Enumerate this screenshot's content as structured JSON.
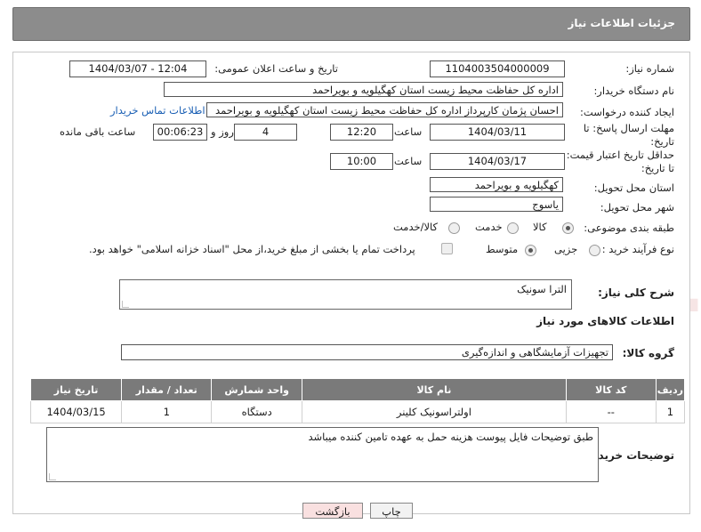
{
  "header": {
    "title": "جزئیات اطلاعات نیاز"
  },
  "watermark": {
    "text": "AriaTender.neT"
  },
  "fields": {
    "need_number_label": "شماره نیاز:",
    "need_number": "1104003504000009",
    "announce_label": "تاریخ و ساعت اعلان عمومی:",
    "announce_value": "1404/03/07 - 12:04",
    "buyer_org_label": "نام دستگاه خریدار:",
    "buyer_org": "اداره کل حفاظت محیط زیست استان کهگیلویه و بویراحمد",
    "creator_label": "ایجاد کننده درخواست:",
    "creator": "احسان پژمان کارپرداز اداره کل حفاظت محیط زیست استان کهگیلویه و بویراحمد",
    "buyer_contact_link": "اطلاعات تماس خریدار",
    "deadline_label": "مهلت ارسال پاسخ: تا تاریخ:",
    "deadline_date": "1404/03/11",
    "time_label": "ساعت",
    "deadline_time": "12:20",
    "days_value": "4",
    "days_label": "روز و",
    "remaining_time": "00:06:23",
    "remaining_label": "ساعت باقی مانده",
    "price_validity_label": "حداقل تاریخ اعتبار قیمت: تا تاریخ:",
    "price_validity_date": "1404/03/17",
    "price_validity_time": "10:00",
    "province_label": "استان محل تحویل:",
    "province": "کهگیلویه و بویراحمد",
    "city_label": "شهر محل تحویل:",
    "city": "یاسوج",
    "category_label": "طبقه بندی موضوعی:",
    "category_options": [
      "کالا",
      "خدمت",
      "کالا/خدمت"
    ],
    "process_label": "نوع فرآیند خرید :",
    "process_options": [
      "جزیی",
      "متوسط"
    ],
    "payment_note": "پرداخت تمام یا بخشی از مبلغ خرید،از محل \"اسناد خزانه اسلامی\" خواهد بود."
  },
  "description": {
    "label": "شرح کلی نیاز:",
    "value": "الترا سونیک"
  },
  "goods_section": {
    "title": "اطلاعات کالاهای مورد نیاز",
    "group_label": "گروه کالا:",
    "group_value": "تجهیزات آزمایشگاهی و اندازه‌گیری"
  },
  "table": {
    "headers": [
      "ردیف",
      "کد کالا",
      "نام کالا",
      "واحد شمارش",
      "تعداد / مقدار",
      "تاریخ نیاز"
    ],
    "rows": [
      [
        "1",
        "--",
        "اولتراسونیک کلینر",
        "دستگاه",
        "1",
        "1404/03/15"
      ]
    ]
  },
  "buyer_notes": {
    "label": "توضیحات خریدار:",
    "value": "طبق توضیحات فایل پیوست هزینه حمل  به عهده تامین کننده میباشد"
  },
  "buttons": {
    "print": "چاپ",
    "back": "بازگشت"
  }
}
